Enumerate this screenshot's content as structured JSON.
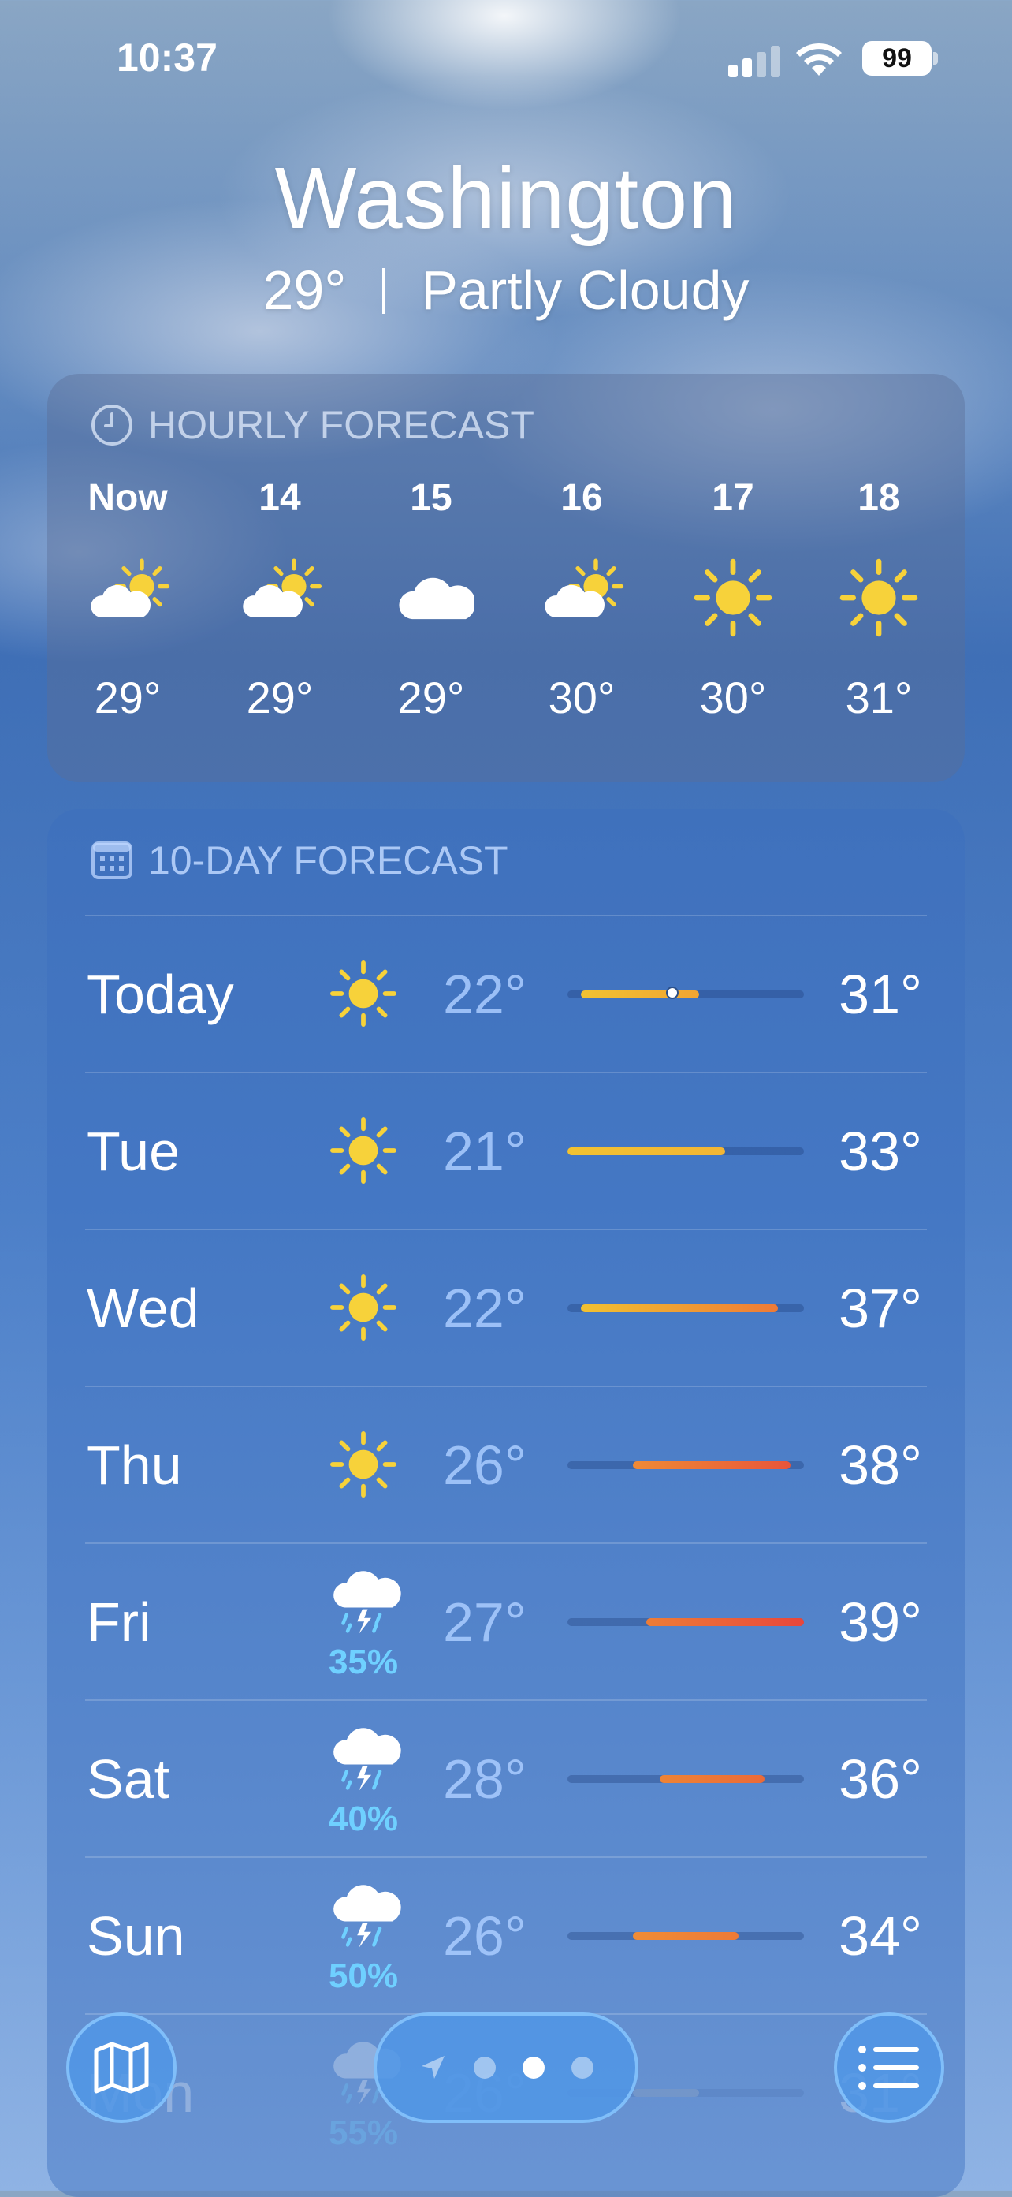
{
  "status_bar": {
    "time": "10:37",
    "battery": "99"
  },
  "location": {
    "city": "Washington",
    "temperature": "29°",
    "condition": "Partly Cloudy"
  },
  "hourly": {
    "title": "HOURLY FORECAST",
    "hours": [
      {
        "label": "Now",
        "icon": "partly-cloudy-icon",
        "temp": "29°"
      },
      {
        "label": "14",
        "icon": "partly-cloudy-icon",
        "temp": "29°"
      },
      {
        "label": "15",
        "icon": "cloud-icon",
        "temp": "29°"
      },
      {
        "label": "16",
        "icon": "partly-cloudy-icon",
        "temp": "30°"
      },
      {
        "label": "17",
        "icon": "sun-icon",
        "temp": "30°"
      },
      {
        "label": "18",
        "icon": "sun-icon",
        "temp": "31°"
      }
    ]
  },
  "daily": {
    "title": "10-DAY FORECAST",
    "range": {
      "min": 21,
      "max": 39
    },
    "current_temp_value": 29,
    "days": [
      {
        "day": "Today",
        "icon": "sun-icon",
        "precip": "",
        "low": "22°",
        "high": "31°",
        "low_value": 22,
        "high_value": 31,
        "gradient": [
          "#f2c231",
          "#f2a532"
        ]
      },
      {
        "day": "Tue",
        "icon": "sun-icon",
        "precip": "",
        "low": "21°",
        "high": "33°",
        "low_value": 21,
        "high_value": 33,
        "gradient": [
          "#f2c231",
          "#f2b534"
        ]
      },
      {
        "day": "Wed",
        "icon": "sun-icon",
        "precip": "",
        "low": "22°",
        "high": "37°",
        "low_value": 22,
        "high_value": 37,
        "gradient": [
          "#f2c231",
          "#ee7a36"
        ]
      },
      {
        "day": "Thu",
        "icon": "sun-icon",
        "precip": "",
        "low": "26°",
        "high": "38°",
        "low_value": 26,
        "high_value": 38,
        "gradient": [
          "#f08a35",
          "#e9553a"
        ]
      },
      {
        "day": "Fri",
        "icon": "thunderstorm-icon",
        "precip": "35%",
        "low": "27°",
        "high": "39°",
        "low_value": 27,
        "high_value": 39,
        "gradient": [
          "#ee7d36",
          "#e8463b"
        ]
      },
      {
        "day": "Sat",
        "icon": "thunderstorm-icon",
        "precip": "40%",
        "low": "28°",
        "high": "36°",
        "low_value": 28,
        "high_value": 36,
        "gradient": [
          "#ef8436",
          "#eb6a38"
        ]
      },
      {
        "day": "Sun",
        "icon": "thunderstorm-icon",
        "precip": "50%",
        "low": "26°",
        "high": "34°",
        "low_value": 26,
        "high_value": 34,
        "gradient": [
          "#f08c35",
          "#ee7a36"
        ]
      },
      {
        "day": "Mon",
        "icon": "thunderstorm-icon",
        "precip": "55%",
        "low": "26°",
        "high": "31°",
        "low_value": 26,
        "high_value": 31,
        "gradient": [
          "#9aa5b8",
          "#9aa5b8"
        ]
      }
    ]
  },
  "toolbar": {
    "pages": 3,
    "active_page": 2
  },
  "colors": {
    "sun": "#f7d23a",
    "precip": "#6fd0ff"
  }
}
